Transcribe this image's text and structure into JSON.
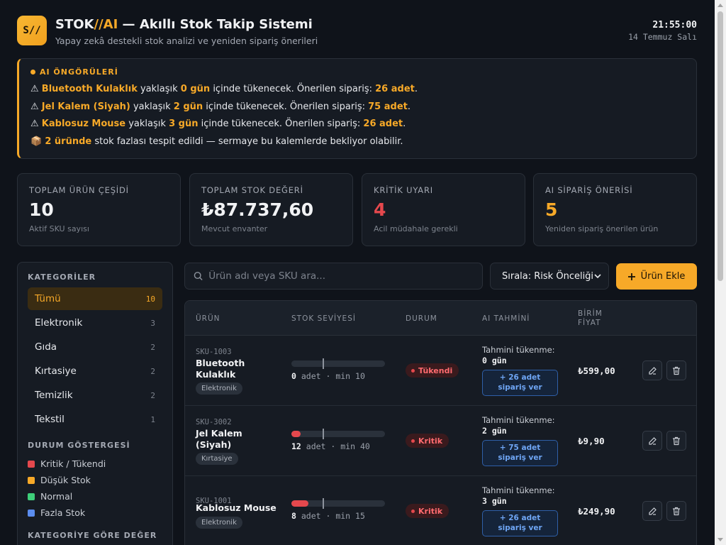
{
  "header": {
    "logo_text": "S//",
    "title_prefix": "STOK",
    "title_accent": "//AI",
    "title_suffix": " — Akıllı Stok Takip Sistemi",
    "subtitle": "Yapay zekâ destekli stok analizi ve yeniden sipariş önerileri",
    "clock": "21:55:00",
    "date": "14 Temmuz Salı"
  },
  "ai_panel": {
    "heading": "AI ÖNGÖRÜLERİ",
    "alerts": [
      {
        "icon": "⚠",
        "product": "Bluetooth Kulaklık",
        "mid1": " yaklaşık ",
        "days": "0 gün",
        "mid2": " içinde tükenecek. Önerilen sipariş: ",
        "qty": "26 adet",
        "end": "."
      },
      {
        "icon": "⚠",
        "product": "Jel Kalem (Siyah)",
        "mid1": " yaklaşık ",
        "days": "2 gün",
        "mid2": " içinde tükenecek. Önerilen sipariş: ",
        "qty": "75 adet",
        "end": "."
      },
      {
        "icon": "⚠",
        "product": "Kablosuz Mouse",
        "mid1": " yaklaşık ",
        "days": "3 gün",
        "mid2": " içinde tükenecek. Önerilen sipariş: ",
        "qty": "26 adet",
        "end": "."
      }
    ],
    "surplus": {
      "icon": "📦",
      "count": "2 üründe",
      "text": " stok fazlası tespit edildi — sermaye bu kalemlerde bekliyor olabilir."
    }
  },
  "stats": [
    {
      "label": "TOPLAM ÜRÜN ÇEŞİDİ",
      "value": "10",
      "sub": "Aktif SKU sayısı",
      "color": "#f1f2f4"
    },
    {
      "label": "TOPLAM STOK DEĞERİ",
      "value": "₺87.737,60",
      "sub": "Mevcut envanter",
      "color": "#f1f2f4"
    },
    {
      "label": "KRİTİK UYARI",
      "value": "4",
      "sub": "Acil müdahale gerekli",
      "color": "#e5484d"
    },
    {
      "label": "AI SİPARİŞ ÖNERİSİ",
      "value": "5",
      "sub": "Yeniden sipariş önerilen ürün",
      "color": "#f7a928"
    }
  ],
  "sidebar": {
    "categories_heading": "KATEGORİLER",
    "categories": [
      {
        "label": "Tümü",
        "count": "10"
      },
      {
        "label": "Elektronik",
        "count": "3"
      },
      {
        "label": "Gıda",
        "count": "2"
      },
      {
        "label": "Kırtasiye",
        "count": "2"
      },
      {
        "label": "Temizlik",
        "count": "2"
      },
      {
        "label": "Tekstil",
        "count": "1"
      }
    ],
    "legend_heading": "DURUM GÖSTERGESİ",
    "legend": [
      {
        "label": "Kritik / Tükendi",
        "color": "#e5484d"
      },
      {
        "label": "Düşük Stok",
        "color": "#f7a928"
      },
      {
        "label": "Normal",
        "color": "#3ecf7a"
      },
      {
        "label": "Fazla Stok",
        "color": "#5b8def"
      }
    ],
    "value_heading": "KATEGORİYE GÖRE DEĞER"
  },
  "toolbar": {
    "search_placeholder": "Ürün adı veya SKU ara...",
    "sort_label": "Sırala: Risk Önceliği",
    "add_label": "Ürün Ekle"
  },
  "table": {
    "headers": {
      "product": "ÜRÜN",
      "stock": "STOK SEVİYESİ",
      "status": "DURUM",
      "ai": "AI TAHMİNİ",
      "price_line1": "BİRİM",
      "price_line2": "FİYAT"
    },
    "rows": [
      {
        "sku": "SKU-1003",
        "name": "Bluetooth Kulaklık",
        "category": "Elektronik",
        "stock": "0",
        "stock_unit": " adet · min ",
        "min": "10",
        "fill": 0,
        "min_ratio": 0.33,
        "status": "Tükendi",
        "pred_label": "Tahmini tükenme:",
        "pred_days": "0 gün",
        "order_line1": "+ 26 adet",
        "order_line2": "sipariş ver",
        "price": "₺599,00"
      },
      {
        "sku": "SKU-3002",
        "name": "Jel Kalem (Siyah)",
        "category": "Kırtasiye",
        "stock": "12",
        "stock_unit": " adet · min ",
        "min": "40",
        "fill": 0.1,
        "min_ratio": 0.33,
        "status": "Kritik",
        "pred_label": "Tahmini tükenme:",
        "pred_days": "2 gün",
        "order_line1": "+ 75 adet",
        "order_line2": "sipariş ver",
        "price": "₺9,90"
      },
      {
        "sku": "SKU-1001",
        "name": "Kablosuz Mouse",
        "category": "Elektronik",
        "stock": "8",
        "stock_unit": " adet · min ",
        "min": "15",
        "fill": 0.18,
        "min_ratio": 0.33,
        "status": "Kritik",
        "pred_label": "Tahmini tükenme:",
        "pred_days": "3 gün",
        "order_line1": "+ 26 adet",
        "order_line2": "sipariş ver",
        "price": "₺249,90"
      }
    ]
  }
}
